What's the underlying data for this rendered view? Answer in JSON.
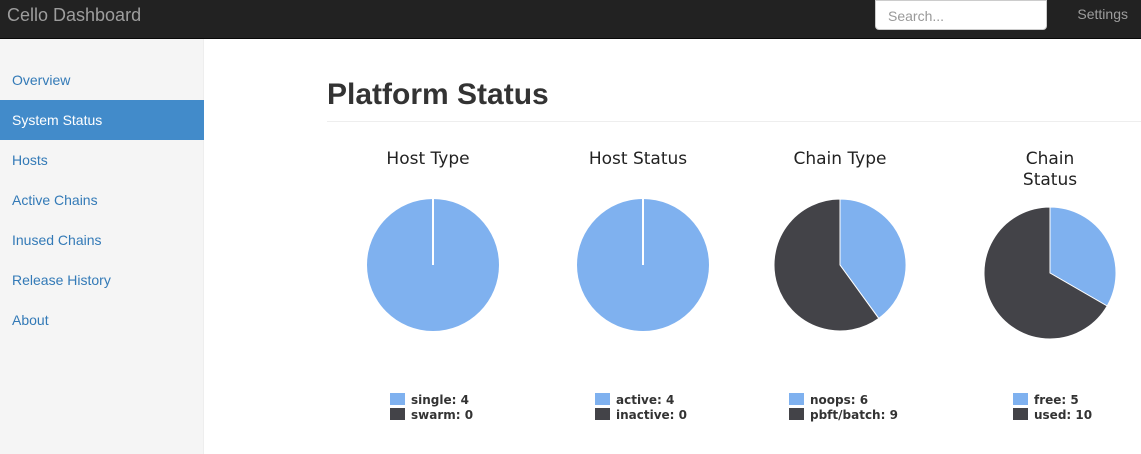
{
  "navbar": {
    "brand": "Cello Dashboard",
    "search_placeholder": "Search...",
    "settings": "Settings"
  },
  "sidebar": {
    "items": [
      {
        "label": "Overview"
      },
      {
        "label": "System Status",
        "active": true
      },
      {
        "label": "Hosts"
      },
      {
        "label": "Active Chains"
      },
      {
        "label": "Inused Chains"
      },
      {
        "label": "Release History"
      },
      {
        "label": "About"
      }
    ]
  },
  "main": {
    "title": "Platform Status"
  },
  "colors": {
    "slice_primary": "#7fb1ef",
    "slice_secondary": "#434348"
  },
  "chart_data": [
    {
      "type": "pie",
      "title": "Host Type",
      "slices": [
        {
          "label": "single",
          "value": 4
        },
        {
          "label": "swarm",
          "value": 0
        }
      ]
    },
    {
      "type": "pie",
      "title": "Host Status",
      "slices": [
        {
          "label": "active",
          "value": 4
        },
        {
          "label": "inactive",
          "value": 0
        }
      ]
    },
    {
      "type": "pie",
      "title": "Chain Type",
      "slices": [
        {
          "label": "noops",
          "value": 6
        },
        {
          "label": "pbft/batch",
          "value": 9
        }
      ]
    },
    {
      "type": "pie",
      "title": "Chain Status",
      "slices": [
        {
          "label": "free",
          "value": 5
        },
        {
          "label": "used",
          "value": 10
        }
      ]
    }
  ]
}
